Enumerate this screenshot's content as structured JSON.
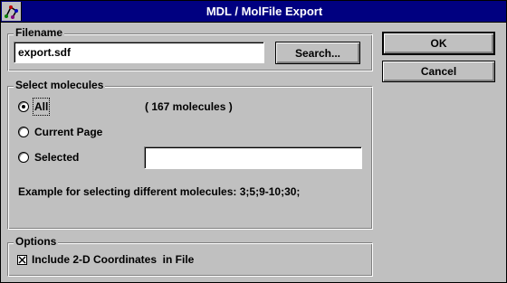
{
  "window": {
    "title": "MDL / MolFile Export",
    "icon": "app-molecule-icon"
  },
  "filename_group": {
    "legend": "Filename",
    "input_value": "export.sdf",
    "search_label": "Search..."
  },
  "buttons": {
    "ok_label": "OK",
    "cancel_label": "Cancel"
  },
  "select_group": {
    "legend": "Select molecules",
    "options": [
      {
        "label": "All",
        "checked": true
      },
      {
        "label": "Current Page",
        "checked": false
      },
      {
        "label": "Selected",
        "checked": false
      }
    ],
    "molecule_count": "( 167 molecules )",
    "selected_value": "",
    "example_text": "Example for selecting different molecules: 3;5;9-10;30;"
  },
  "options_group": {
    "legend": "Options",
    "include_2d_label": "Include 2-D Coordinates  in File",
    "include_2d_checked": true
  }
}
